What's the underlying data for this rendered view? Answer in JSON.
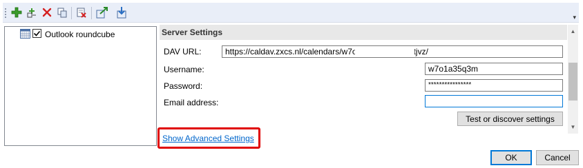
{
  "toolbar": {
    "buttons": [
      {
        "icon": "add-icon"
      },
      {
        "icon": "add-multiple-icon"
      },
      {
        "icon": "delete-icon"
      },
      {
        "icon": "copy-icon"
      },
      {
        "icon": "clear-cache-icon"
      },
      {
        "icon": "export-icon"
      },
      {
        "icon": "import-icon"
      }
    ],
    "overflow_icon": "overflow-chevron-icon"
  },
  "tree": {
    "items": [
      {
        "label": "Outlook roundcube",
        "checked": true,
        "icon": "calendar-icon"
      }
    ]
  },
  "server_settings": {
    "title": "Server Settings",
    "dav_url": {
      "label": "DAV URL:",
      "value": "https://caldav.zxcs.nl/calendars/w7o1a35q3m/pvhj7tjvz/"
    },
    "username": {
      "label": "Username:",
      "value": "w7o1a35q3m"
    },
    "password": {
      "label": "Password:",
      "value": "****************"
    },
    "email": {
      "label": "Email address:",
      "value": ""
    },
    "test_button": "Test or discover settings"
  },
  "advanced_link": "Show Advanced Settings",
  "dialog": {
    "ok": "OK",
    "cancel": "Cancel"
  },
  "colors": {
    "accent_red": "#e00000",
    "link": "#0066cc",
    "focus_border": "#0078d7"
  }
}
